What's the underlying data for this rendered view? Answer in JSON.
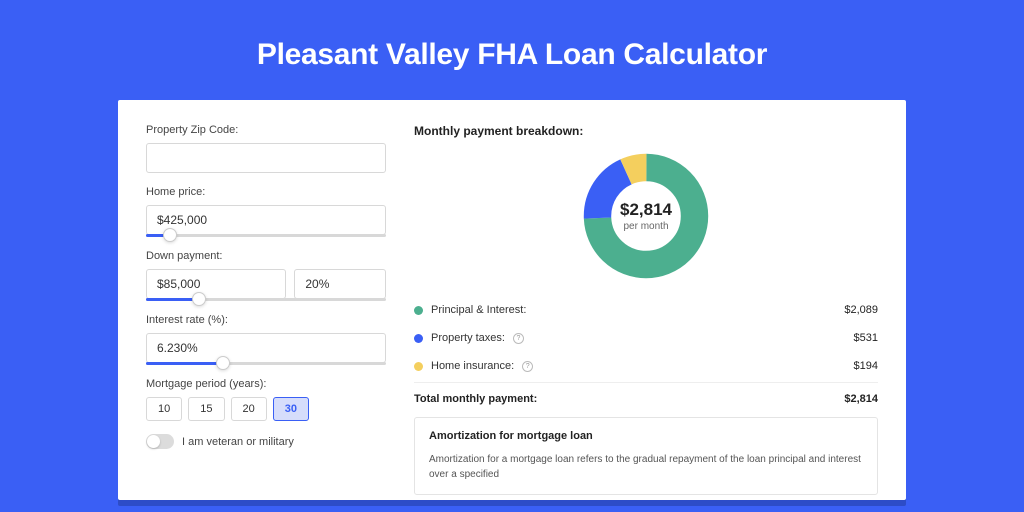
{
  "title": "Pleasant Valley FHA Loan Calculator",
  "left": {
    "zip_label": "Property Zip Code:",
    "zip_value": "",
    "home_price_label": "Home price:",
    "home_price_value": "$425,000",
    "home_price_slider_pct": 10,
    "down_label": "Down payment:",
    "down_value": "$85,000",
    "down_pct_value": "20%",
    "down_slider_pct": 22,
    "rate_label": "Interest rate (%):",
    "rate_value": "6.230%",
    "rate_slider_pct": 32,
    "period_label": "Mortgage period (years):",
    "periods": [
      "10",
      "15",
      "20",
      "30"
    ],
    "period_active": 3,
    "veteran_label": "I am veteran or military"
  },
  "right": {
    "breakdown_title": "Monthly payment breakdown:",
    "donut_amount": "$2,814",
    "donut_sub": "per month",
    "rows": [
      {
        "color": "green",
        "label": "Principal & Interest:",
        "info": false,
        "value": "$2,089"
      },
      {
        "color": "blue",
        "label": "Property taxes:",
        "info": true,
        "value": "$531"
      },
      {
        "color": "yellow",
        "label": "Home insurance:",
        "info": true,
        "value": "$194"
      }
    ],
    "total_label": "Total monthly payment:",
    "total_value": "$2,814",
    "amort_title": "Amortization for mortgage loan",
    "amort_text": "Amortization for a mortgage loan refers to the gradual repayment of the loan principal and interest over a specified"
  },
  "chart_data": {
    "type": "pie",
    "title": "Monthly payment breakdown",
    "series": [
      {
        "name": "Principal & Interest",
        "value": 2089,
        "color": "#4caf8f"
      },
      {
        "name": "Property taxes",
        "value": 531,
        "color": "#3a5ff5"
      },
      {
        "name": "Home insurance",
        "value": 194,
        "color": "#f4cf5e"
      }
    ],
    "total": 2814,
    "center_label": "$2,814 per month"
  }
}
